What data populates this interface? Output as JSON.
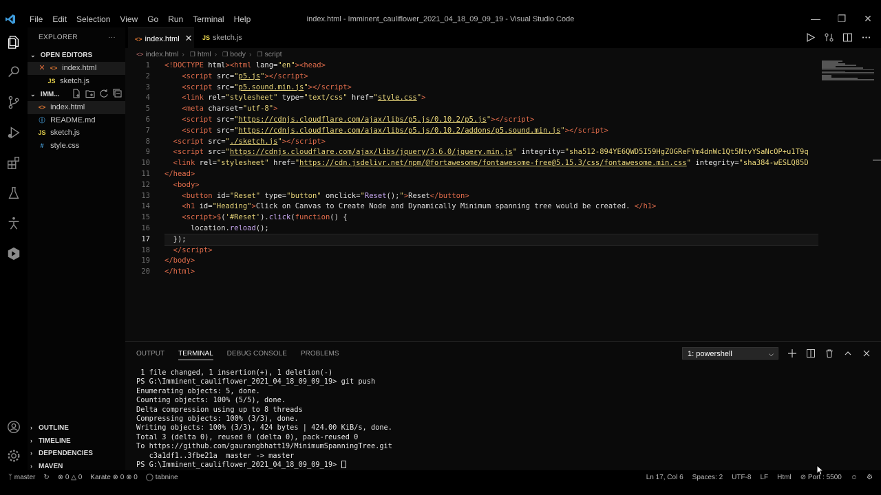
{
  "menus": [
    "File",
    "Edit",
    "Selection",
    "View",
    "Go",
    "Run",
    "Terminal",
    "Help"
  ],
  "window_title": "index.html - Imminent_cauliflower_2021_04_18_09_09_19 - Visual Studio Code",
  "sidebar": {
    "title": "EXPLORER",
    "more": "···",
    "open_editors": {
      "label": "OPEN EDITORS",
      "items": [
        {
          "name": "index.html",
          "icon": "<>"
        },
        {
          "name": "sketch.js",
          "icon": "JS"
        }
      ]
    },
    "project": {
      "label": "IMM...",
      "files": [
        {
          "name": "index.html",
          "icon": "<>"
        },
        {
          "name": "README.md",
          "icon": "ⓘ"
        },
        {
          "name": "sketch.js",
          "icon": "JS"
        },
        {
          "name": "style.css",
          "icon": "#"
        }
      ]
    },
    "bottom_sections": [
      "OUTLINE",
      "TIMELINE",
      "DEPENDENCIES",
      "MAVEN"
    ]
  },
  "tabs": [
    {
      "label": "index.html",
      "icon": "<>",
      "close": "✕"
    },
    {
      "label": "sketch.js",
      "icon": "JS"
    }
  ],
  "breadcrumb": [
    "index.html",
    "html",
    "body",
    "script"
  ],
  "editor": {
    "current_line": 17,
    "line_numbers": [
      "1",
      "2",
      "3",
      "4",
      "5",
      "6",
      "7",
      "8",
      "9",
      "10",
      "11",
      "12",
      "13",
      "14",
      "15",
      "16",
      "17",
      "18",
      "19",
      "20"
    ]
  },
  "panel": {
    "tabs": [
      "OUTPUT",
      "TERMINAL",
      "DEBUG CONSOLE",
      "PROBLEMS"
    ],
    "active_tab": "TERMINAL",
    "shell": "1: powershell",
    "terminal_lines": [
      " 1 file changed, 1 insertion(+), 1 deletion(-)",
      "PS G:\\Imminent_cauliflower_2021_04_18_09_09_19> git push",
      "Enumerating objects: 5, done.",
      "Counting objects: 100% (5/5), done.",
      "Delta compression using up to 8 threads",
      "Compressing objects: 100% (3/3), done.",
      "Writing objects: 100% (3/3), 424 bytes | 424.00 KiB/s, done.",
      "Total 3 (delta 0), reused 0 (delta 0), pack-reused 0",
      "To https://github.com/gaurangbhatt19/MinimumSpanningTree.git",
      "   c3a1df1..3fbe21a  master -> master",
      "PS G:\\Imminent_cauliflower_2021_04_18_09_09_19> "
    ]
  },
  "status": {
    "branch": "master",
    "errors": "0",
    "warnings": "0",
    "karate": "Karate",
    "karate_a": "0",
    "karate_b": "0",
    "tabnine": "tabnine",
    "position": "Ln 17, Col 6",
    "spaces": "Spaces: 2",
    "encoding": "UTF-8",
    "eol": "LF",
    "language": "Html",
    "port": "Port : 5500"
  },
  "colors": {
    "tag": "#e06c4b",
    "string": "#e9d67a",
    "background": "#0c0c0c"
  }
}
